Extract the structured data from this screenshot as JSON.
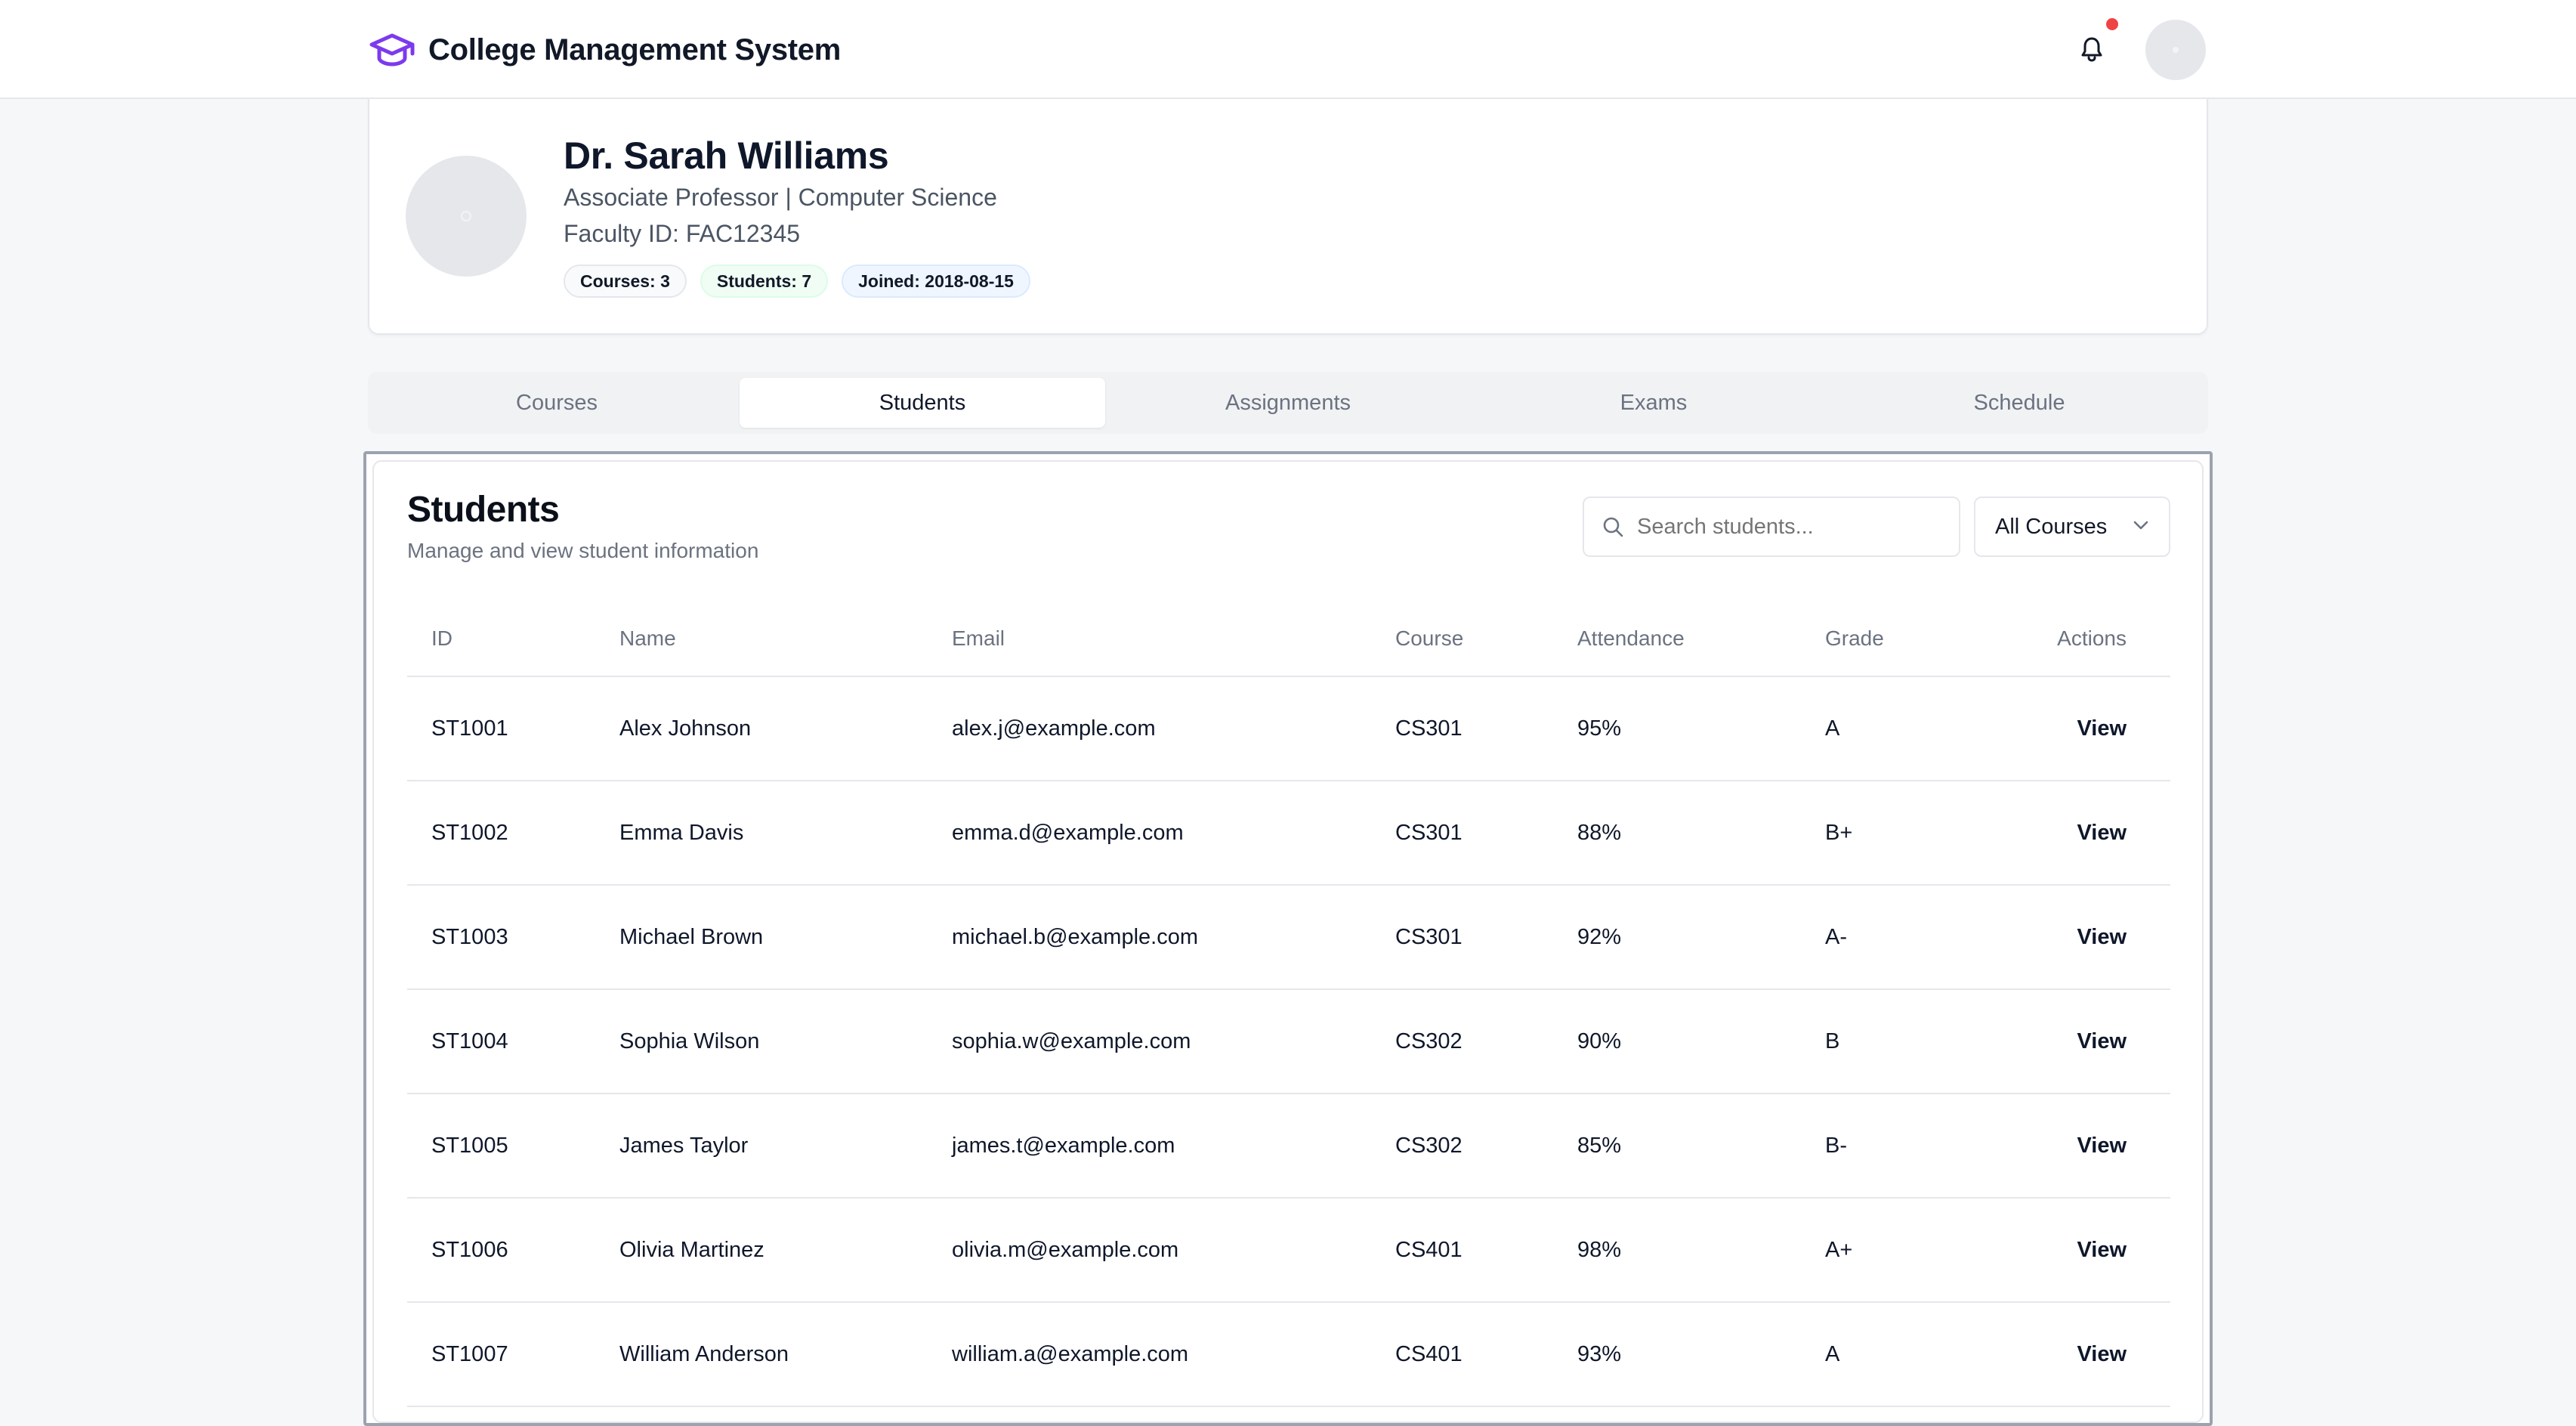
{
  "header": {
    "title": "College Management System",
    "icons": {
      "brand": "graduation-cap-icon",
      "notifications": "bell-icon"
    },
    "accent_color": "#7c3aed",
    "notification_dot_color": "#ef4444"
  },
  "profile": {
    "name": "Dr. Sarah Williams",
    "title": "Associate Professor | Computer Science",
    "faculty_id": "Faculty ID: FAC12345",
    "badges": {
      "courses": "Courses: 3",
      "students": "Students: 7",
      "joined": "Joined: 2018-08-15"
    }
  },
  "tabs": [
    {
      "label": "Courses",
      "active": false
    },
    {
      "label": "Students",
      "active": true
    },
    {
      "label": "Assignments",
      "active": false
    },
    {
      "label": "Exams",
      "active": false
    },
    {
      "label": "Schedule",
      "active": false
    }
  ],
  "students_panel": {
    "title": "Students",
    "subtitle": "Manage and view student information",
    "search_placeholder": "Search students...",
    "filter_selected": "All Courses",
    "columns": [
      "ID",
      "Name",
      "Email",
      "Course",
      "Attendance",
      "Grade",
      "Actions"
    ],
    "rows": [
      {
        "id": "ST1001",
        "name": "Alex Johnson",
        "email": "alex.j@example.com",
        "course": "CS301",
        "attendance": "95%",
        "grade": "A",
        "action": "View"
      },
      {
        "id": "ST1002",
        "name": "Emma Davis",
        "email": "emma.d@example.com",
        "course": "CS301",
        "attendance": "88%",
        "grade": "B+",
        "action": "View"
      },
      {
        "id": "ST1003",
        "name": "Michael Brown",
        "email": "michael.b@example.com",
        "course": "CS301",
        "attendance": "92%",
        "grade": "A-",
        "action": "View"
      },
      {
        "id": "ST1004",
        "name": "Sophia Wilson",
        "email": "sophia.w@example.com",
        "course": "CS302",
        "attendance": "90%",
        "grade": "B",
        "action": "View"
      },
      {
        "id": "ST1005",
        "name": "James Taylor",
        "email": "james.t@example.com",
        "course": "CS302",
        "attendance": "85%",
        "grade": "B-",
        "action": "View"
      },
      {
        "id": "ST1006",
        "name": "Olivia Martinez",
        "email": "olivia.m@example.com",
        "course": "CS401",
        "attendance": "98%",
        "grade": "A+",
        "action": "View"
      },
      {
        "id": "ST1007",
        "name": "William Anderson",
        "email": "william.a@example.com",
        "course": "CS401",
        "attendance": "93%",
        "grade": "A",
        "action": "View"
      }
    ]
  }
}
